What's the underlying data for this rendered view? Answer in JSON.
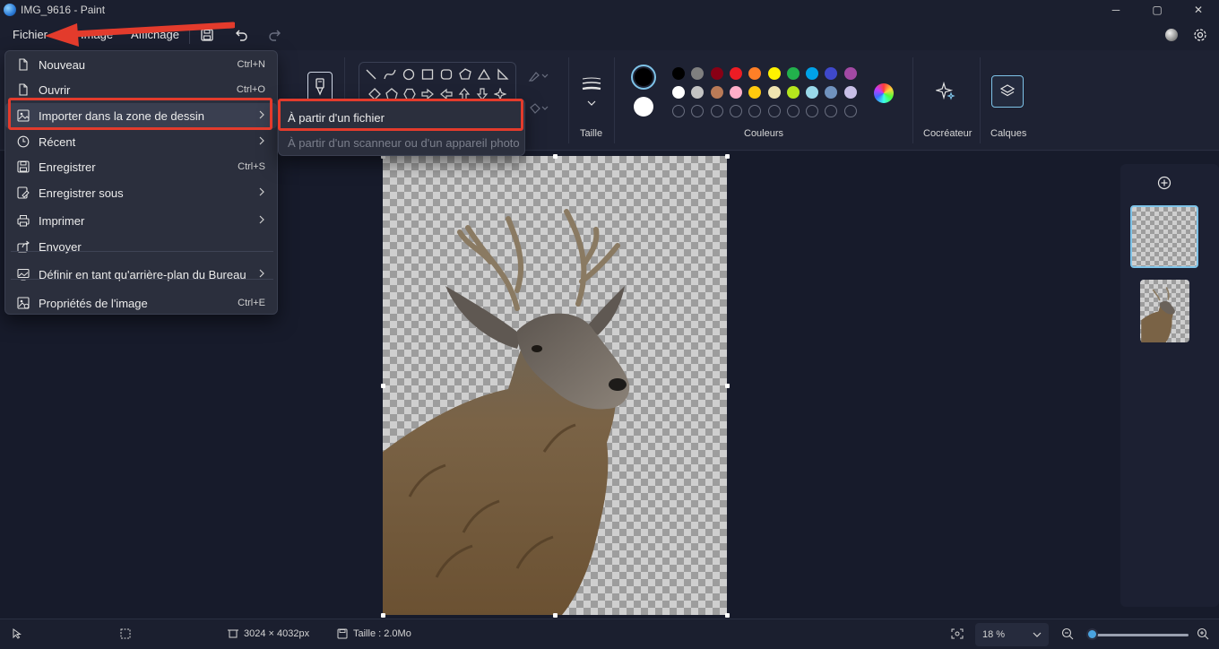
{
  "window": {
    "title": "IMG_9616 - Paint",
    "min": "─",
    "max": "▢",
    "close": "✕"
  },
  "menubar": {
    "fichier": "Fichier",
    "image": "Image",
    "affichage": "Affichage"
  },
  "ribbon": {
    "taille_label": "Taille",
    "couleurs_label": "Couleurs",
    "cocreateur_label": "Cocréateur",
    "calques_label": "Calques",
    "primary_color": "#000000",
    "secondary_color": "#ffffff",
    "palette_row1": [
      "#000000",
      "#7f7f7f",
      "#880015",
      "#ed1c24",
      "#ff7f27",
      "#fff200",
      "#22b14c",
      "#00a2e8",
      "#3f48cc",
      "#a349a4"
    ],
    "palette_row2": [
      "#ffffff",
      "#c3c3c3",
      "#b97a57",
      "#ffaec9",
      "#ffc90e",
      "#efe4b0",
      "#b5e61d",
      "#99d9ea",
      "#7092be",
      "#c8bfe7"
    ]
  },
  "file_menu": {
    "items": [
      {
        "label": "Nouveau",
        "shortcut": "Ctrl+N",
        "icon": "new-file-icon"
      },
      {
        "label": "Ouvrir",
        "shortcut": "Ctrl+O",
        "icon": "open-file-icon"
      },
      {
        "label": "Importer dans la zone de dessin",
        "shortcut": "",
        "icon": "import-icon",
        "submenu": true
      },
      {
        "label": "Récent",
        "shortcut": "",
        "icon": "clock-icon",
        "submenu": true
      },
      {
        "label": "Enregistrer",
        "shortcut": "Ctrl+S",
        "icon": "save-icon"
      },
      {
        "label": "Enregistrer sous",
        "shortcut": "",
        "icon": "save-as-icon",
        "submenu": true
      },
      {
        "label": "Imprimer",
        "shortcut": "",
        "icon": "printer-icon",
        "submenu": true
      },
      {
        "label": "Envoyer",
        "shortcut": "",
        "icon": "share-icon"
      },
      {
        "label": "Définir en tant qu'arrière-plan du Bureau",
        "shortcut": "",
        "icon": "desktop-icon",
        "submenu": true
      },
      {
        "label": "Propriétés de l'image",
        "shortcut": "Ctrl+E",
        "icon": "properties-icon"
      }
    ]
  },
  "submenu": {
    "from_file": "À partir d'un fichier",
    "from_scanner": "À partir d'un scanneur ou d'un appareil photo"
  },
  "statusbar": {
    "dimensions": "3024 × 4032px",
    "size": "Taille : 2.0Mo",
    "zoom": "18 %",
    "zoom_level": 0.18
  }
}
